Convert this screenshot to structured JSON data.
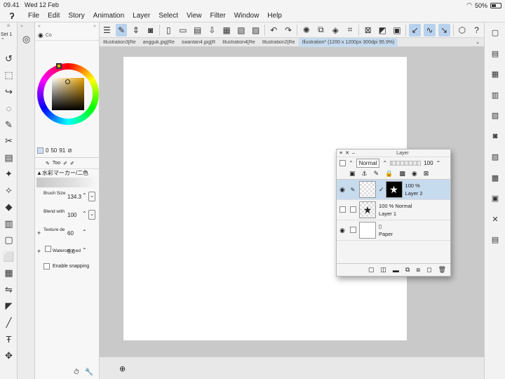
{
  "status": {
    "time": "09.41",
    "date": "Wed 12 Feb",
    "wifi_icon": "wifi-icon",
    "battery": "50%"
  },
  "menu": {
    "items": [
      "File",
      "Edit",
      "Story",
      "Animation",
      "Layer",
      "Select",
      "View",
      "Filter",
      "Window",
      "Help"
    ]
  },
  "lefttools": {
    "set_label": "Set 1"
  },
  "color": {
    "tab_label": "Co",
    "v1": "0",
    "v2": "50",
    "v3": "91"
  },
  "toolprop": {
    "tab_label": "Too",
    "title": "▲水彩マーカー/二色",
    "brush_size_label": "Brush Size",
    "brush_size": "134.3",
    "blend_label": "Blend with",
    "blend": "100",
    "texture_label": "Texture de",
    "texture": "60",
    "watercolor_label": "Watercolor ed",
    "watercolor": "5.0",
    "snap_label": "Enable snapping"
  },
  "tabs": [
    "Illustration3[Re",
    "angguk.jpg[Re",
    "swantari4.jpg[R",
    "Illustration4[Re",
    "Illustration2[Re",
    "Illustration* (1200 x 1200px 300dpi 95.9%)"
  ],
  "layer": {
    "title": "Layer",
    "blend_mode": "Normal",
    "opacity": "100",
    "rows": [
      {
        "opacity": "100 %",
        "name": "Layer 2"
      },
      {
        "opacity": "100 % Normal",
        "name": "Layer 1"
      },
      {
        "opacity": "",
        "name": "Paper"
      }
    ]
  }
}
